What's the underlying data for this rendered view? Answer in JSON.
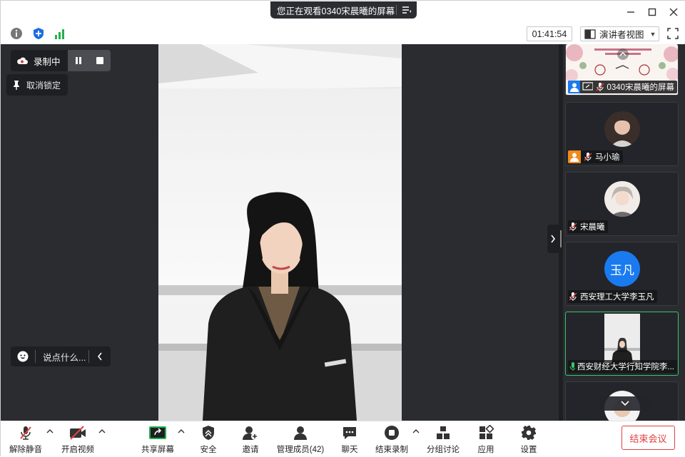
{
  "title_bar": {
    "sharing_text": "您正在观看0340宋晨曦的屏幕"
  },
  "top_bar": {
    "timer": "01:41:54",
    "view_label": "演讲者视图"
  },
  "stage": {
    "recording_label": "录制中",
    "unpin_label": "取消锁定",
    "say_placeholder": "说点什么..."
  },
  "participants": [
    {
      "name": "0340宋晨曦的屏幕",
      "avatar_text": "",
      "mic": "muted",
      "active": false
    },
    {
      "name": "马小瑜",
      "avatar_text": "",
      "mic": "muted",
      "active": false
    },
    {
      "name": "宋晨曦",
      "avatar_text": "",
      "mic": "muted",
      "active": false
    },
    {
      "name": "西安理工大学李玉凡",
      "avatar_text": "玉凡",
      "mic": "muted",
      "active": false
    },
    {
      "name": "西安财经大学行知学院李...",
      "avatar_text": "",
      "mic": "on",
      "active": true
    }
  ],
  "toolbar": {
    "unmute": "解除静音",
    "start_video": "开启视频",
    "share_screen": "共享屏幕",
    "security": "安全",
    "invite": "邀请",
    "manage_members": "管理成员(42)",
    "chat": "聊天",
    "end_recording": "结束录制",
    "breakout": "分组讨论",
    "apps": "应用",
    "settings": "设置",
    "end_meeting": "结束会议"
  },
  "colors": {
    "stage_bg": "#2a2c30",
    "active_border": "#3cc46a",
    "end_red": "#e34040",
    "avatar_blue": "#1a7af0"
  }
}
